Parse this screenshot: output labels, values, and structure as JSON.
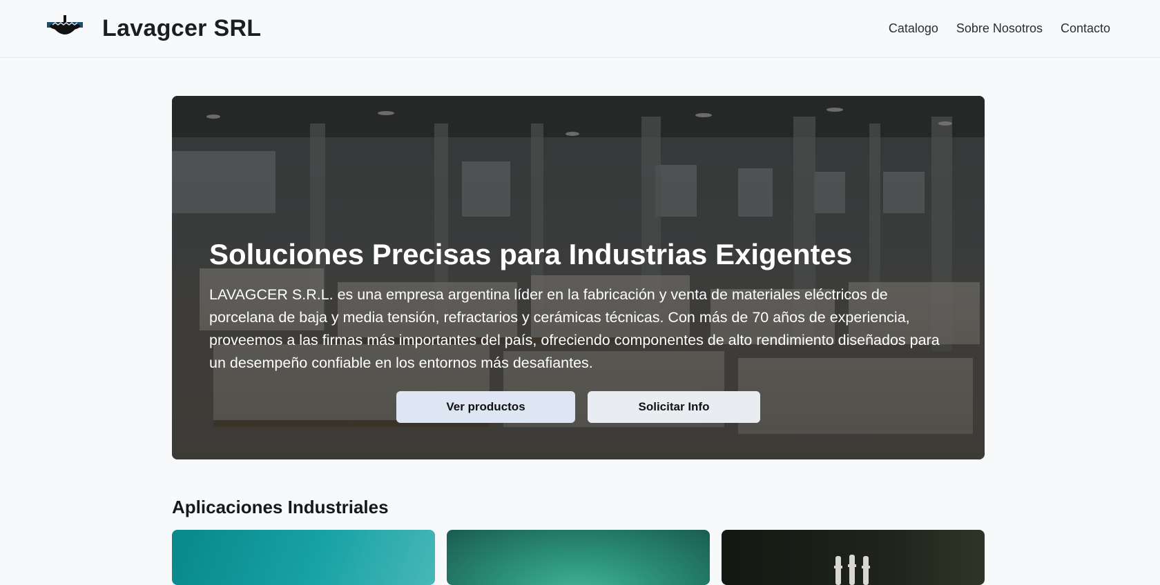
{
  "header": {
    "brand": "Lavagcer SRL",
    "logo_icon": "porcelain-insulator-logo-icon",
    "nav": [
      {
        "label": "Catalogo"
      },
      {
        "label": "Sobre Nosotros"
      },
      {
        "label": "Contacto"
      }
    ]
  },
  "hero": {
    "title": "Soluciones Precisas para Industrias Exigentes",
    "description": "LAVAGCER S.R.L. es una empresa argentina líder en la fabricación y venta de materiales eléctricos de porcelana de baja y media tensión, refractarios y cerámicas técnicas. Con más de 70 años de experiencia, proveemos a las firmas más importantes del país, ofreciendo componentes de alto rendimiento diseñados para un desempeño confiable en los entornos más desafiantes.",
    "primary_button": "Ver productos",
    "secondary_button": "Solicitar Info"
  },
  "applications": {
    "title": "Aplicaciones Industriales"
  },
  "colors": {
    "page_background": "#f8f9fb",
    "primary_button": "#dde6f2",
    "secondary_button": "#e9ecf1",
    "card_teal": "#17a2a4",
    "card_green": "#2b8f79",
    "card_dark": "#1e231b"
  }
}
